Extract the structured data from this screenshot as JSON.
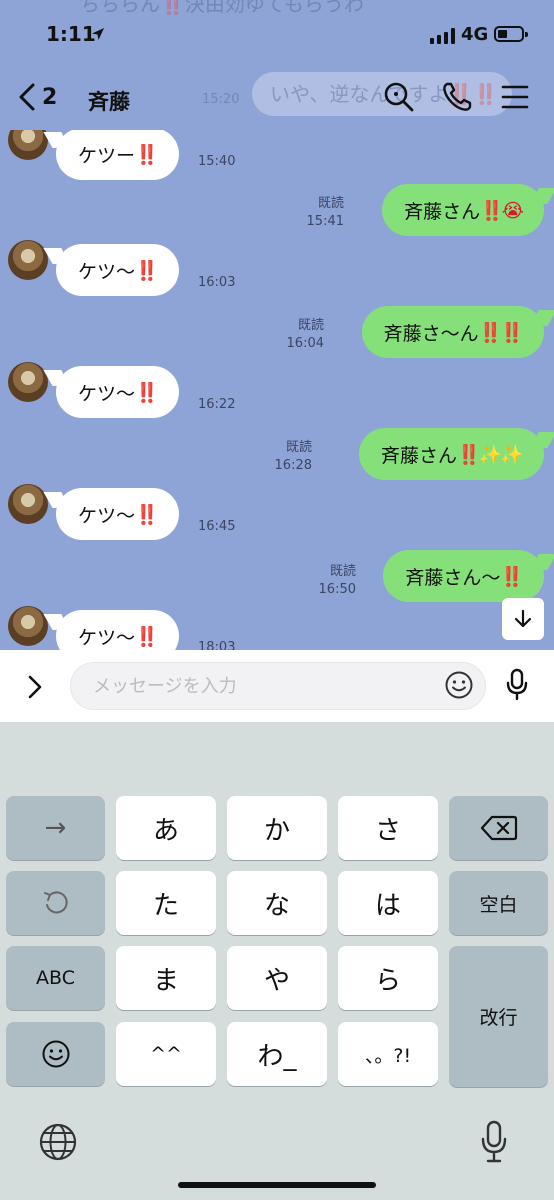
{
  "status": {
    "time": "1:11",
    "network": "4G"
  },
  "background_peek": {
    "top_snippet": "ちちらん‼️決由効ゆてもらうわ",
    "right_snippet": "いや、逆なんですよ‼️‼️",
    "peek_time": "15:20"
  },
  "header": {
    "back_count": "2",
    "title": "斉藤"
  },
  "messages": [
    {
      "side": "in",
      "text": "ケツー",
      "bangs": "‼️",
      "time": "15:40"
    },
    {
      "side": "out",
      "text": "斉藤さん",
      "bangs": "‼️😭",
      "read": "既読",
      "time": "15:41"
    },
    {
      "side": "in",
      "text": "ケツ〜",
      "bangs": "‼️",
      "time": "16:03"
    },
    {
      "side": "out",
      "text": "斉藤さ〜ん",
      "bangs": "‼️‼️",
      "read": "既読",
      "time": "16:04"
    },
    {
      "side": "in",
      "text": "ケツ〜",
      "bangs": "‼️",
      "time": "16:22"
    },
    {
      "side": "out",
      "text": "斉藤さん",
      "bangs": "‼️✨✨",
      "read": "既読",
      "time": "16:28"
    },
    {
      "side": "in",
      "text": "ケツ〜",
      "bangs": "‼️",
      "time": "16:45"
    },
    {
      "side": "out",
      "text": "斉藤さん〜",
      "bangs": "‼️",
      "read": "既読",
      "time": "16:50"
    },
    {
      "side": "in",
      "text": "ケツ〜",
      "bangs": "‼️",
      "time": "18:03"
    }
  ],
  "input": {
    "placeholder": "メッセージを入力"
  },
  "keyboard": {
    "rows": [
      [
        "→",
        "あ",
        "か",
        "さ",
        "⌫"
      ],
      [
        "↺",
        "た",
        "な",
        "は",
        "空白"
      ],
      [
        "ABC",
        "ま",
        "や",
        "ら",
        "改行"
      ],
      [
        "☺",
        "^^",
        "わ_",
        "、。?!"
      ]
    ]
  },
  "colors": {
    "chat_bg": "#8fa4d6",
    "outgoing_bubble": "#86e07a",
    "incoming_bubble": "#ffffff",
    "exclamation": "#d8192a",
    "keyboard_bg": "#d4dcdc",
    "key_dark": "#aebdc3"
  }
}
